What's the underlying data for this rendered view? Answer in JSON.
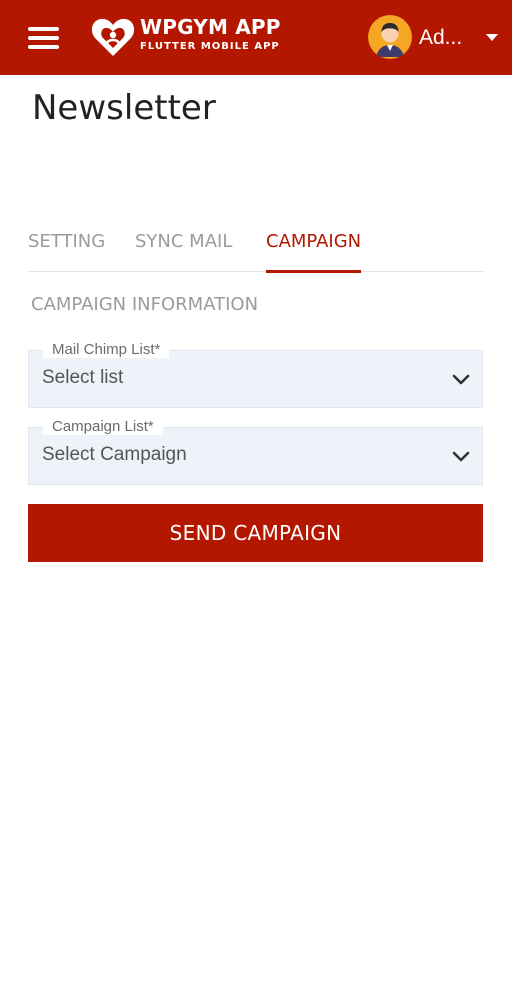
{
  "header": {
    "brand_title": "WPGYM APP",
    "brand_subtitle": "FLUTTER MOBILE APP",
    "user_name": "Ad...",
    "icons": {
      "menu": "hamburger-menu-icon",
      "logo": "heart-logo-icon",
      "avatar": "user-avatar",
      "caret": "caret-down-icon"
    },
    "accent_color": "#b41700"
  },
  "page": {
    "title": "Newsletter"
  },
  "tabs": [
    {
      "label": "SETTING",
      "active": false
    },
    {
      "label": "SYNC MAIL",
      "active": false
    },
    {
      "label": "CAMPAIGN",
      "active": true
    }
  ],
  "campaign": {
    "section_title": "CAMPAIGN INFORMATION",
    "fields": [
      {
        "label": "Mail Chimp List*",
        "value": "Select list"
      },
      {
        "label": "Campaign List*",
        "value": "Select Campaign"
      }
    ],
    "send_button": "SEND CAMPAIGN"
  }
}
